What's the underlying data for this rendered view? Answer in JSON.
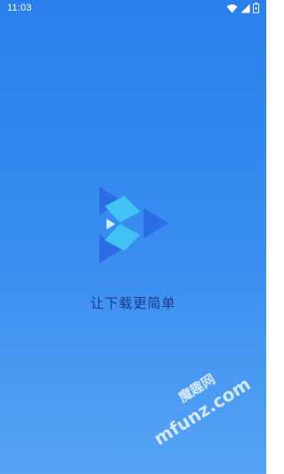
{
  "status_bar": {
    "time": "11:03",
    "icons": [
      "wifi-icon",
      "signal-icon",
      "battery-icon"
    ]
  },
  "splash": {
    "logo_icon": "download-logo-icon",
    "tagline": "让下载更简单"
  },
  "watermark": {
    "cn": "魔趣网",
    "en": "mfunz.com"
  },
  "colors": {
    "background_top": "#2a80ea",
    "background_bottom": "#56a3f5",
    "tagline": "#1c3a86",
    "logo_dark": "#2c6de6",
    "logo_light": "#42c2f2"
  }
}
